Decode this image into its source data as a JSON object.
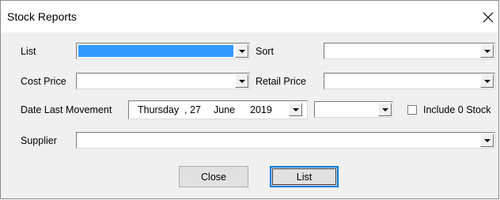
{
  "window": {
    "title": "Stock Reports"
  },
  "fields": {
    "list_label": "List",
    "sort_label": "Sort",
    "cost_price_label": "Cost Price",
    "retail_price_label": "Retail Price",
    "date_last_movement_label": "Date Last Movement",
    "supplier_label": "Supplier",
    "include_zero_stock_label": "Include 0 Stock",
    "include_zero_stock_checked": false,
    "date": {
      "weekday": "Thursday",
      "separator": ",",
      "day": "27",
      "month": "June",
      "year": "2019"
    }
  },
  "buttons": {
    "close": "Close",
    "list": "List"
  },
  "colors": {
    "selection": "#3399ff",
    "default_button_border": "#0078d7"
  }
}
